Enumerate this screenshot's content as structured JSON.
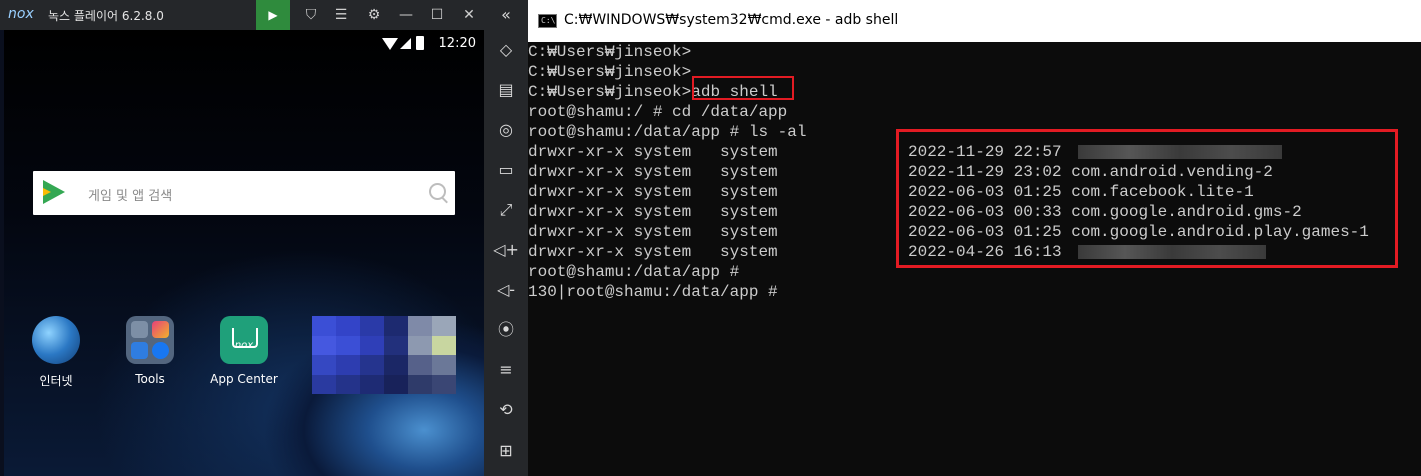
{
  "nox": {
    "logo": "nox",
    "title": "녹스 플레이어 6.2.8.0",
    "buttons": {
      "play": "▶",
      "shirt": "⛉",
      "menu": "☰",
      "settings": "⚙",
      "minimize": "—",
      "maximize": "☐",
      "close": "✕",
      "collapse": "«"
    }
  },
  "android": {
    "status": {
      "time": "12:20"
    },
    "search": {
      "placeholder": "게임 및 앱 검색"
    },
    "apps": [
      {
        "label": "인터넷"
      },
      {
        "label": "Tools"
      },
      {
        "label": "App Center",
        "icon_text": "nox"
      }
    ]
  },
  "toolbar": {
    "icons": [
      "◇",
      "▤",
      "◎",
      "▭",
      "⤢",
      "◁+",
      "◁-",
      "⦿",
      "≡",
      "⟲",
      "⊞"
    ]
  },
  "cmd": {
    "title": "C:₩WINDOWS₩system32₩cmd.exe - adb  shell",
    "icon_text": "C:\\",
    "prompt_lines": [
      "C:₩Users₩jinseok>",
      "C:₩Users₩jinseok>"
    ],
    "adb_prompt": "C:₩Users₩jinseok>",
    "adb_command": "adb shell",
    "cd_line": "root@shamu:/ # cd /data/app",
    "ls_line": "root@shamu:/data/app # ls -al",
    "listing": [
      {
        "perm": "drwxr-xr-x system   system",
        "date": "2022-11-29 22:57",
        "name": ""
      },
      {
        "perm": "drwxr-xr-x system   system",
        "date": "2022-11-29 23:02",
        "name": "com.android.vending-2"
      },
      {
        "perm": "drwxr-xr-x system   system",
        "date": "2022-06-03 01:25",
        "name": "com.facebook.lite-1"
      },
      {
        "perm": "drwxr-xr-x system   system",
        "date": "2022-06-03 00:33",
        "name": "com.google.android.gms-2"
      },
      {
        "perm": "drwxr-xr-x system   system",
        "date": "2022-06-03 01:25",
        "name": "com.google.android.play.games-1"
      },
      {
        "perm": "drwxr-xr-x system   system",
        "date": "2022-04-26 16:13",
        "name": ""
      }
    ],
    "end_prompt": "root@shamu:/data/app #",
    "final_prompt": "130|root@shamu:/data/app #",
    "highlight_color": "#e31b23"
  }
}
